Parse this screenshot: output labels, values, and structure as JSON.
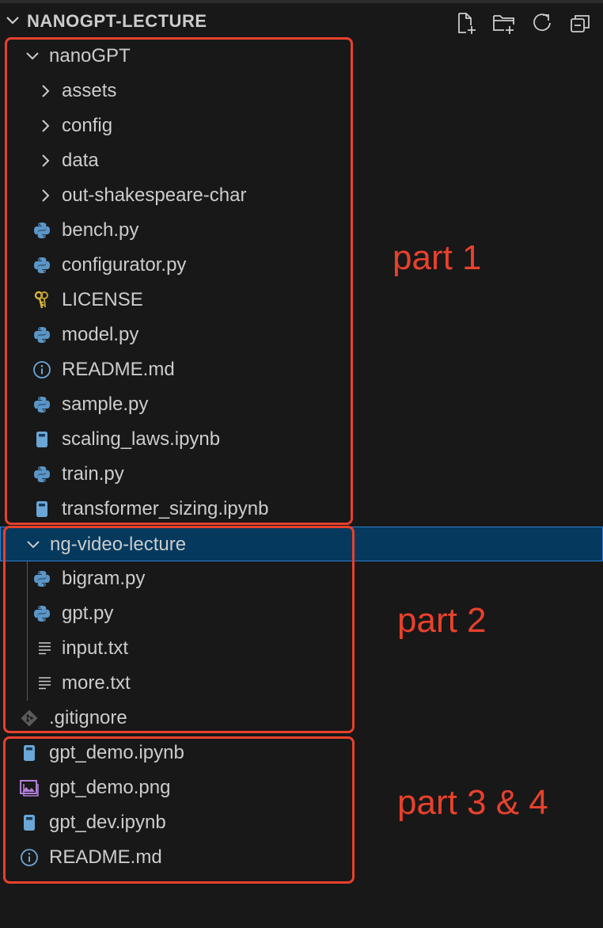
{
  "explorer": {
    "title": "NANOGPT-LECTURE",
    "actions": [
      {
        "icon": "new-file-icon"
      },
      {
        "icon": "new-folder-icon"
      },
      {
        "icon": "refresh-icon"
      },
      {
        "icon": "collapse-all-icon"
      }
    ]
  },
  "tree": {
    "nanogpt": {
      "label": "nanoGPT",
      "folders": [
        "assets",
        "config",
        "data",
        "out-shakespeare-char"
      ],
      "files": [
        {
          "name": "bench.py",
          "icon": "python-icon"
        },
        {
          "name": "configurator.py",
          "icon": "python-icon"
        },
        {
          "name": "LICENSE",
          "icon": "license-key-icon"
        },
        {
          "name": "model.py",
          "icon": "python-icon"
        },
        {
          "name": "README.md",
          "icon": "info-icon"
        },
        {
          "name": "sample.py",
          "icon": "python-icon"
        },
        {
          "name": "scaling_laws.ipynb",
          "icon": "notebook-icon"
        },
        {
          "name": "train.py",
          "icon": "python-icon"
        },
        {
          "name": "transformer_sizing.ipynb",
          "icon": "notebook-icon"
        }
      ]
    },
    "ng_video_lecture": {
      "label": "ng-video-lecture",
      "files": [
        {
          "name": "bigram.py",
          "icon": "python-icon"
        },
        {
          "name": "gpt.py",
          "icon": "python-icon"
        },
        {
          "name": "input.txt",
          "icon": "text-file-icon"
        },
        {
          "name": "more.txt",
          "icon": "text-file-icon"
        }
      ]
    },
    "root_files": [
      {
        "name": ".gitignore",
        "icon": "git-icon"
      },
      {
        "name": "gpt_demo.ipynb",
        "icon": "notebook-icon"
      },
      {
        "name": "gpt_demo.png",
        "icon": "image-icon"
      },
      {
        "name": "gpt_dev.ipynb",
        "icon": "notebook-icon"
      },
      {
        "name": "README.md",
        "icon": "info-icon"
      }
    ]
  },
  "annotations": {
    "part1": "part 1",
    "part2": "part 2",
    "part3": "part 3 & 4"
  },
  "colors": {
    "annotation": "#e8412c",
    "selection": "#05395e",
    "python": "#5a96c8",
    "notebook": "#6aa6d6",
    "image": "#b180d7",
    "license": "#d5b43f",
    "info": "#6aa6d6"
  }
}
